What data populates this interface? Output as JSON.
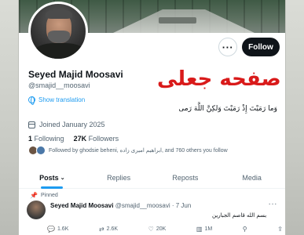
{
  "profile": {
    "display_name": "Seyed Majid Moosavi",
    "handle": "@smajid__moosavi",
    "translate_label": "Show translation",
    "bio": "وَما رَمَیْتَ إِذْ رَمَیْتَ وَلكِنَّ اللَّهَ رَمى",
    "joined": "Joined January 2025",
    "following_count": "1",
    "following_label": "Following",
    "followers_count": "27K",
    "followers_label": "Followers",
    "followed_by": "Followed by ghodsie beheni, ابراهیم امیری زاده, and 760 others you follow"
  },
  "overlay": {
    "stamp_text": "صفحه جعلی",
    "stamp_color": "#d91a1a"
  },
  "actions": {
    "more_label": "···",
    "follow_label": "Follow"
  },
  "tabs": [
    {
      "label": "Posts",
      "active": true
    },
    {
      "label": "Replies",
      "active": false
    },
    {
      "label": "Reposts",
      "active": false
    },
    {
      "label": "Media",
      "active": false
    }
  ],
  "pinned_post": {
    "pinned_label": "Pinned",
    "author_name": "Seyed Majid Moosavi",
    "author_handle": "@smajid__moosavi",
    "date": "· 7 Jun",
    "text": "بسم الله قاصم الجبارین",
    "metrics": {
      "replies": "1.6K",
      "reposts": "2.6K",
      "likes": "20K",
      "views": "1M"
    }
  },
  "colors": {
    "accent": "#1d9bf0",
    "text": "#0f1419",
    "muted": "#536471"
  }
}
